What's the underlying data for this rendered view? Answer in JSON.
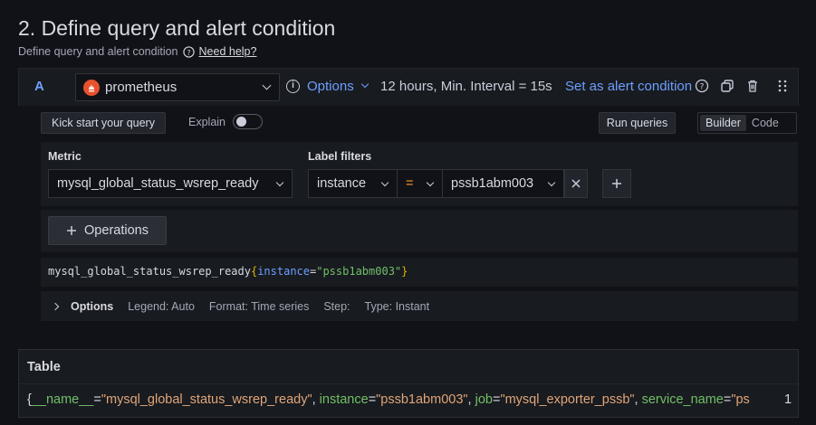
{
  "section": {
    "title": "2. Define query and alert condition",
    "subtitle": "Define query and alert condition",
    "help_link": "Need help?"
  },
  "query": {
    "ref_id": "A",
    "datasource": "prometheus",
    "options_label": "Options",
    "interval_info": "12 hours, Min. Interval = 15s",
    "alert_condition_link": "Set as alert condition"
  },
  "toolbar": {
    "kick_start": "Kick start your query",
    "explain_label": "Explain",
    "run_queries": "Run queries",
    "modes": [
      "Builder",
      "Code"
    ],
    "active_mode": "Builder"
  },
  "builder": {
    "metric_label": "Metric",
    "metric_value": "mysql_global_status_wsrep_ready",
    "label_filters_label": "Label filters",
    "filter_label": "instance",
    "filter_operator": "=",
    "filter_value": "pssb1abm003",
    "operations_button": "Operations"
  },
  "preview": {
    "metric": "mysql_global_status_wsrep_ready",
    "open_brace": "{",
    "key": "instance",
    "eq": "=",
    "value": "\"pssb1abm003\"",
    "close_brace": "}"
  },
  "options_row": {
    "label": "Options",
    "legend": "Legend: Auto",
    "format": "Format: Time series",
    "step": "Step:",
    "type": "Type: Instant"
  },
  "table": {
    "title": "Table",
    "row": {
      "open": "{",
      "k1": "__name__",
      "v1": "\"mysql_global_status_wsrep_ready\"",
      "k2": "instance",
      "v2": "\"pssb1abm003\"",
      "k3": "job",
      "v3": "\"mysql_exporter_pssb\"",
      "k4": "service_name",
      "v4": "\"ps",
      "eq": "=",
      "sep": ", ",
      "value": "1"
    }
  },
  "colors": {
    "accent": "#6e9fff",
    "prometheus": "#e6522c",
    "string_green": "#73bf69",
    "operator_orange": "#ff9830"
  }
}
